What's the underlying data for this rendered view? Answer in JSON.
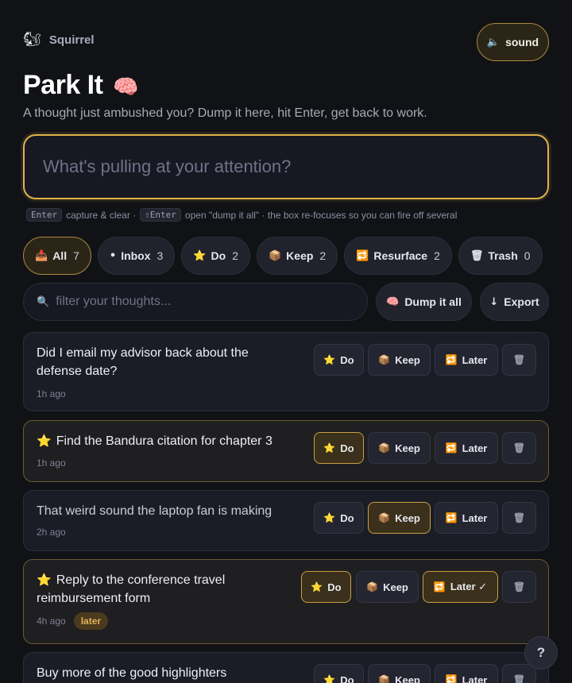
{
  "brand": {
    "icon": "squirrel-icon",
    "emoji": "🐿",
    "name": "Squirrel"
  },
  "sound": {
    "icon": "speaker-muted-icon",
    "glyph": "🔈",
    "label": "sound"
  },
  "header": {
    "title": "Park It",
    "title_emoji": "🧠",
    "subtitle": "A thought just ambushed you? Dump it here, hit Enter, get back to work."
  },
  "capture": {
    "placeholder": "What's pulling at your attention?",
    "value": ""
  },
  "hint": {
    "key1": "Enter",
    "text1": "capture & clear ·",
    "key2": "⇧Enter",
    "text2": "open \"dump it all\" · the box re-focuses so you can fire off several"
  },
  "filters": [
    {
      "id": "all",
      "icon": "inbox-tray-icon",
      "glyph": "📥",
      "label": "All",
      "count": "7",
      "active": true
    },
    {
      "id": "inbox",
      "icon": "dot-icon",
      "glyph": "•",
      "label": "Inbox",
      "count": "3",
      "active": false
    },
    {
      "id": "do",
      "icon": "star-icon",
      "glyph": "⭐",
      "label": "Do",
      "count": "2",
      "active": false
    },
    {
      "id": "keep",
      "icon": "package-icon",
      "glyph": "📦",
      "label": "Keep",
      "count": "2",
      "active": false
    },
    {
      "id": "resurface",
      "icon": "repeat-icon",
      "glyph": "🔁",
      "label": "Resurface",
      "count": "2",
      "active": false
    },
    {
      "id": "trash",
      "icon": "wastebasket-icon",
      "glyph": "🗑",
      "label": "Trash",
      "count": "0",
      "active": false
    }
  ],
  "search": {
    "icon": "magnifier-icon",
    "glyph": "🔍",
    "placeholder": "filter your thoughts...",
    "value": ""
  },
  "dump_all": {
    "icon": "brain-icon",
    "glyph": "🧠",
    "label": "Dump it all"
  },
  "export": {
    "icon": "download-arrow-icon",
    "glyph": "↓",
    "label": "Export"
  },
  "actions": {
    "do": {
      "glyph": "⭐",
      "label": "Do"
    },
    "keep": {
      "glyph": "📦",
      "label": "Keep"
    },
    "later": {
      "glyph": "🔁",
      "label": "Later",
      "checked_label": "Later ✓"
    },
    "trash": {
      "glyph": "🗑"
    }
  },
  "thoughts": [
    {
      "text": "Did I email my advisor back about the defense date?",
      "time": "1h ago",
      "starred": false,
      "state": null,
      "tag": ""
    },
    {
      "text": "Find the Bandura citation for chapter 3",
      "time": "1h ago",
      "starred": true,
      "state": "do",
      "tag": ""
    },
    {
      "text": "That weird sound the laptop fan is making",
      "time": "2h ago",
      "starred": false,
      "state": "keep",
      "tag": ""
    },
    {
      "text": "Reply to the conference travel reimbursement form",
      "time": "4h ago",
      "starred": true,
      "state": "later-do",
      "tag": "later"
    },
    {
      "text": "Buy more of the good highlighters",
      "time": "",
      "starred": false,
      "state": null,
      "tag": ""
    }
  ],
  "help": {
    "label": "?"
  }
}
